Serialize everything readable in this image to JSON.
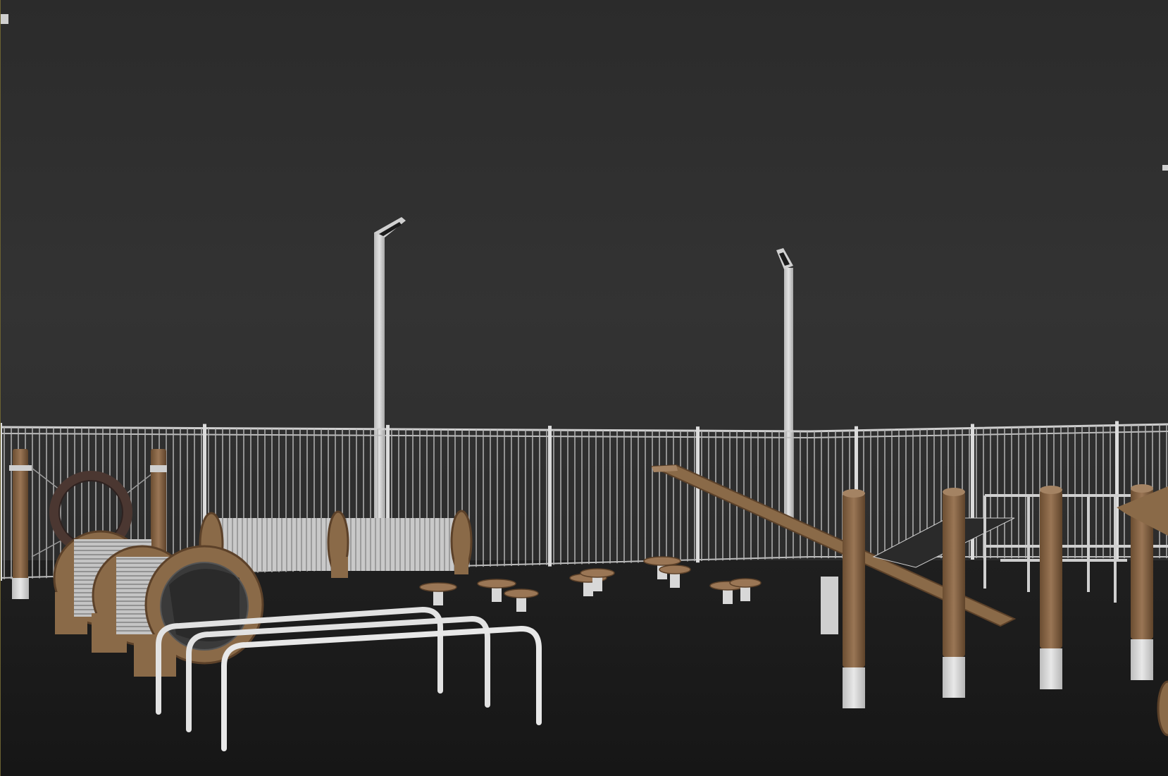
{
  "viewport": {
    "kind": "3d-render-viewport",
    "background_top": "#2e2e2e",
    "background_bottom": "#1b1b1b",
    "ground_color": "#1a1a1a"
  },
  "scene": {
    "objects": [
      "metal-fence",
      "light-pole",
      "light-pole",
      "ring-jump",
      "barrel-tunnel",
      "long-metal-tunnel",
      "stepping-stools",
      "hurdle-hoops",
      "dog-walk-ramp",
      "wooden-posts",
      "low-platform"
    ]
  },
  "colors": {
    "wood": "#8a6a48",
    "wood_dark": "#6b4d31",
    "metal": "#c8c8c8",
    "metal_shadow": "#8e8e8e",
    "ring": "#4e3a34",
    "concrete": "#d7d7d7"
  }
}
